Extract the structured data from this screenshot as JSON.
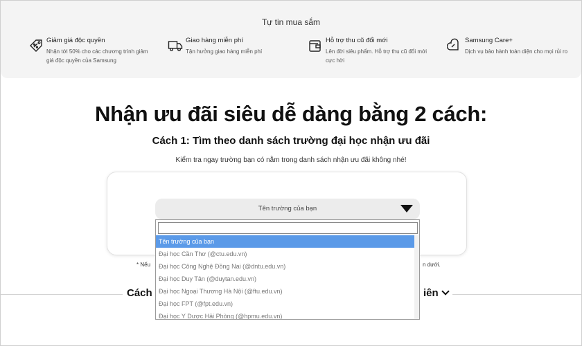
{
  "banner": {
    "title": "Tự tin mua sắm",
    "benefits": [
      {
        "icon": "discount-tag-icon",
        "title": "Giảm giá độc quyền",
        "desc": "Nhận tới 50% cho các chương trình giảm giá độc quyền của Samsung"
      },
      {
        "icon": "delivery-truck-icon",
        "title": "Giao hàng miễn phí",
        "desc": "Tận hưởng giao hàng miễn phí"
      },
      {
        "icon": "trade-in-wallet-icon",
        "title": "Hỗ trợ thu cũ đổi mới",
        "desc": "Lên đời siêu phẩm. Hỗ trợ thu cũ đổi mới cực hời"
      },
      {
        "icon": "care-heart-icon",
        "title": "Samsung Care+",
        "desc": "Dịch vụ bảo hành toàn diện cho mọi rủi ro"
      }
    ]
  },
  "main": {
    "heading": "Nhận ưu đãi siêu dễ dàng bằng 2 cách:",
    "method1": {
      "title": "Cách 1: Tìm theo danh sách trường đại học nhận ưu đãi",
      "subtitle": "Kiểm tra ngay trường bạn có nằm trong danh sách nhận ưu đãi không nhé!"
    },
    "select": {
      "selected": "Tên trường của bạn",
      "search_value": "",
      "options": [
        "Tên trường của bạn",
        "Đại học Cần Thơ (@ctu.edu.vn)",
        "Đại học Công Nghệ Đồng Nai (@dntu.edu.vn)",
        "Đại học Duy Tân (@duytan.edu.vn)",
        "Đại học Ngoại Thương Hà Nội (@ftu.edu.vn)",
        "Đại học FPT (@fpt.edu.vn)",
        "Đại học Y Dược Hải Phòng (@hpmu.edu.vn)"
      ]
    },
    "note_left": "* Nếu",
    "note_right": "n dưới.",
    "method2_left": "Cách",
    "method2_right": "iên"
  }
}
